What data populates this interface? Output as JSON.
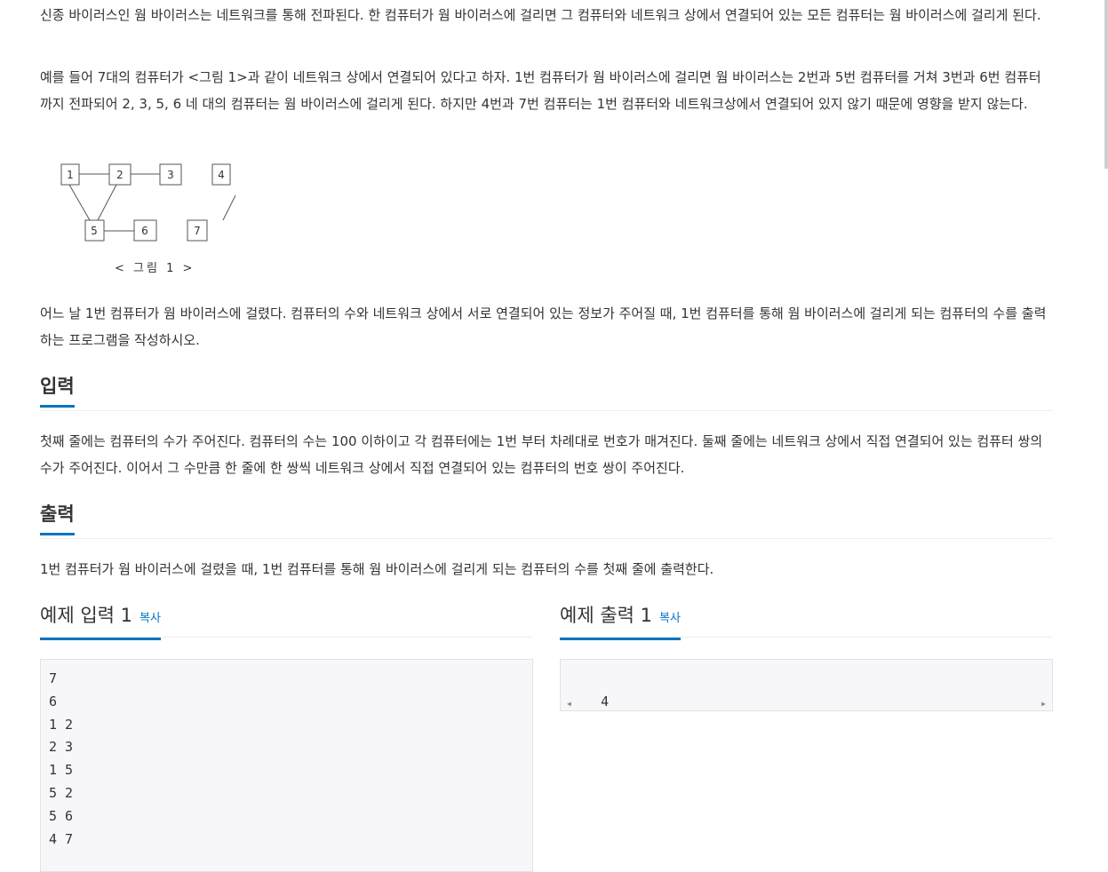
{
  "description": {
    "p1": "신종 바이러스인 웜 바이러스는 네트워크를 통해 전파된다. 한 컴퓨터가 웜 바이러스에 걸리면 그 컴퓨터와 네트워크 상에서 연결되어 있는 모든 컴퓨터는 웜 바이러스에 걸리게 된다.",
    "p2": "예를 들어 7대의 컴퓨터가 <그림 1>과 같이 네트워크 상에서 연결되어 있다고 하자. 1번 컴퓨터가 웜 바이러스에 걸리면 웜 바이러스는 2번과 5번 컴퓨터를 거쳐 3번과 6번 컴퓨터까지 전파되어 2, 3, 5, 6 네 대의 컴퓨터는 웜 바이러스에 걸리게 된다. 하지만 4번과 7번 컴퓨터는 1번 컴퓨터와 네트워크상에서 연결되어 있지 않기 때문에 영향을 받지 않는다.",
    "p3": "어느 날 1번 컴퓨터가 웜 바이러스에 걸렸다. 컴퓨터의 수와 네트워크 상에서 서로 연결되어 있는 정보가 주어질 때, 1번 컴퓨터를 통해 웜 바이러스에 걸리게 되는 컴퓨터의 수를 출력하는 프로그램을 작성하시오."
  },
  "figure": {
    "caption": "< 그림 1 >",
    "nodes": [
      "1",
      "2",
      "3",
      "4",
      "5",
      "6",
      "7"
    ]
  },
  "input_section": {
    "title": "입력",
    "text": "첫째 줄에는 컴퓨터의 수가 주어진다. 컴퓨터의 수는 100 이하이고 각 컴퓨터에는 1번 부터 차례대로 번호가 매겨진다. 둘째 줄에는 네트워크 상에서 직접 연결되어 있는 컴퓨터 쌍의 수가 주어진다. 이어서 그 수만큼 한 줄에 한 쌍씩 네트워크 상에서 직접 연결되어 있는 컴퓨터의 번호 쌍이 주어진다."
  },
  "output_section": {
    "title": "출력",
    "text": "1번 컴퓨터가 웜 바이러스에 걸렸을 때, 1번 컴퓨터를 통해 웜 바이러스에 걸리게 되는 컴퓨터의 수를 첫째 줄에 출력한다."
  },
  "sample_input": {
    "title": "예제 입력 1",
    "copy_label": "복사",
    "content": "7\n6\n1 2\n2 3\n1 5\n5 2\n5 6\n4 7"
  },
  "sample_output": {
    "title": "예제 출력 1",
    "copy_label": "복사",
    "content": "4"
  },
  "colors": {
    "accent": "#0076c0",
    "text": "#333333",
    "pre_bg": "#f7f7f9"
  }
}
